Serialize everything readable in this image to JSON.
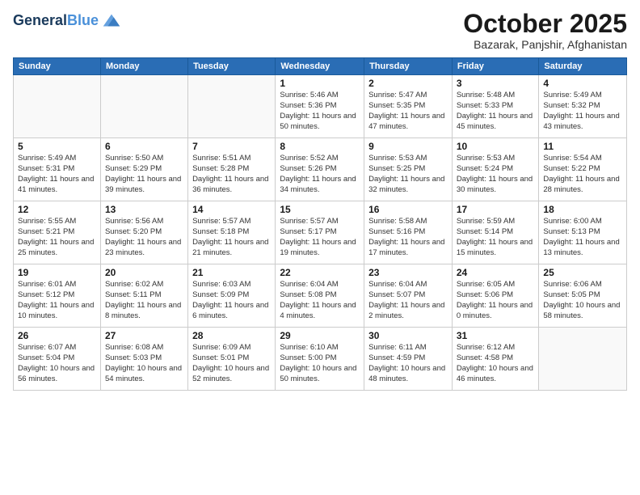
{
  "header": {
    "logo_line1": "General",
    "logo_line2": "Blue",
    "title": "October 2025",
    "subtitle": "Bazarak, Panjshir, Afghanistan"
  },
  "weekdays": [
    "Sunday",
    "Monday",
    "Tuesday",
    "Wednesday",
    "Thursday",
    "Friday",
    "Saturday"
  ],
  "weeks": [
    [
      {
        "day": "",
        "info": ""
      },
      {
        "day": "",
        "info": ""
      },
      {
        "day": "",
        "info": ""
      },
      {
        "day": "1",
        "info": "Sunrise: 5:46 AM\nSunset: 5:36 PM\nDaylight: 11 hours\nand 50 minutes."
      },
      {
        "day": "2",
        "info": "Sunrise: 5:47 AM\nSunset: 5:35 PM\nDaylight: 11 hours\nand 47 minutes."
      },
      {
        "day": "3",
        "info": "Sunrise: 5:48 AM\nSunset: 5:33 PM\nDaylight: 11 hours\nand 45 minutes."
      },
      {
        "day": "4",
        "info": "Sunrise: 5:49 AM\nSunset: 5:32 PM\nDaylight: 11 hours\nand 43 minutes."
      }
    ],
    [
      {
        "day": "5",
        "info": "Sunrise: 5:49 AM\nSunset: 5:31 PM\nDaylight: 11 hours\nand 41 minutes."
      },
      {
        "day": "6",
        "info": "Sunrise: 5:50 AM\nSunset: 5:29 PM\nDaylight: 11 hours\nand 39 minutes."
      },
      {
        "day": "7",
        "info": "Sunrise: 5:51 AM\nSunset: 5:28 PM\nDaylight: 11 hours\nand 36 minutes."
      },
      {
        "day": "8",
        "info": "Sunrise: 5:52 AM\nSunset: 5:26 PM\nDaylight: 11 hours\nand 34 minutes."
      },
      {
        "day": "9",
        "info": "Sunrise: 5:53 AM\nSunset: 5:25 PM\nDaylight: 11 hours\nand 32 minutes."
      },
      {
        "day": "10",
        "info": "Sunrise: 5:53 AM\nSunset: 5:24 PM\nDaylight: 11 hours\nand 30 minutes."
      },
      {
        "day": "11",
        "info": "Sunrise: 5:54 AM\nSunset: 5:22 PM\nDaylight: 11 hours\nand 28 minutes."
      }
    ],
    [
      {
        "day": "12",
        "info": "Sunrise: 5:55 AM\nSunset: 5:21 PM\nDaylight: 11 hours\nand 25 minutes."
      },
      {
        "day": "13",
        "info": "Sunrise: 5:56 AM\nSunset: 5:20 PM\nDaylight: 11 hours\nand 23 minutes."
      },
      {
        "day": "14",
        "info": "Sunrise: 5:57 AM\nSunset: 5:18 PM\nDaylight: 11 hours\nand 21 minutes."
      },
      {
        "day": "15",
        "info": "Sunrise: 5:57 AM\nSunset: 5:17 PM\nDaylight: 11 hours\nand 19 minutes."
      },
      {
        "day": "16",
        "info": "Sunrise: 5:58 AM\nSunset: 5:16 PM\nDaylight: 11 hours\nand 17 minutes."
      },
      {
        "day": "17",
        "info": "Sunrise: 5:59 AM\nSunset: 5:14 PM\nDaylight: 11 hours\nand 15 minutes."
      },
      {
        "day": "18",
        "info": "Sunrise: 6:00 AM\nSunset: 5:13 PM\nDaylight: 11 hours\nand 13 minutes."
      }
    ],
    [
      {
        "day": "19",
        "info": "Sunrise: 6:01 AM\nSunset: 5:12 PM\nDaylight: 11 hours\nand 10 minutes."
      },
      {
        "day": "20",
        "info": "Sunrise: 6:02 AM\nSunset: 5:11 PM\nDaylight: 11 hours\nand 8 minutes."
      },
      {
        "day": "21",
        "info": "Sunrise: 6:03 AM\nSunset: 5:09 PM\nDaylight: 11 hours\nand 6 minutes."
      },
      {
        "day": "22",
        "info": "Sunrise: 6:04 AM\nSunset: 5:08 PM\nDaylight: 11 hours\nand 4 minutes."
      },
      {
        "day": "23",
        "info": "Sunrise: 6:04 AM\nSunset: 5:07 PM\nDaylight: 11 hours\nand 2 minutes."
      },
      {
        "day": "24",
        "info": "Sunrise: 6:05 AM\nSunset: 5:06 PM\nDaylight: 11 hours\nand 0 minutes."
      },
      {
        "day": "25",
        "info": "Sunrise: 6:06 AM\nSunset: 5:05 PM\nDaylight: 10 hours\nand 58 minutes."
      }
    ],
    [
      {
        "day": "26",
        "info": "Sunrise: 6:07 AM\nSunset: 5:04 PM\nDaylight: 10 hours\nand 56 minutes."
      },
      {
        "day": "27",
        "info": "Sunrise: 6:08 AM\nSunset: 5:03 PM\nDaylight: 10 hours\nand 54 minutes."
      },
      {
        "day": "28",
        "info": "Sunrise: 6:09 AM\nSunset: 5:01 PM\nDaylight: 10 hours\nand 52 minutes."
      },
      {
        "day": "29",
        "info": "Sunrise: 6:10 AM\nSunset: 5:00 PM\nDaylight: 10 hours\nand 50 minutes."
      },
      {
        "day": "30",
        "info": "Sunrise: 6:11 AM\nSunset: 4:59 PM\nDaylight: 10 hours\nand 48 minutes."
      },
      {
        "day": "31",
        "info": "Sunrise: 6:12 AM\nSunset: 4:58 PM\nDaylight: 10 hours\nand 46 minutes."
      },
      {
        "day": "",
        "info": ""
      }
    ]
  ]
}
